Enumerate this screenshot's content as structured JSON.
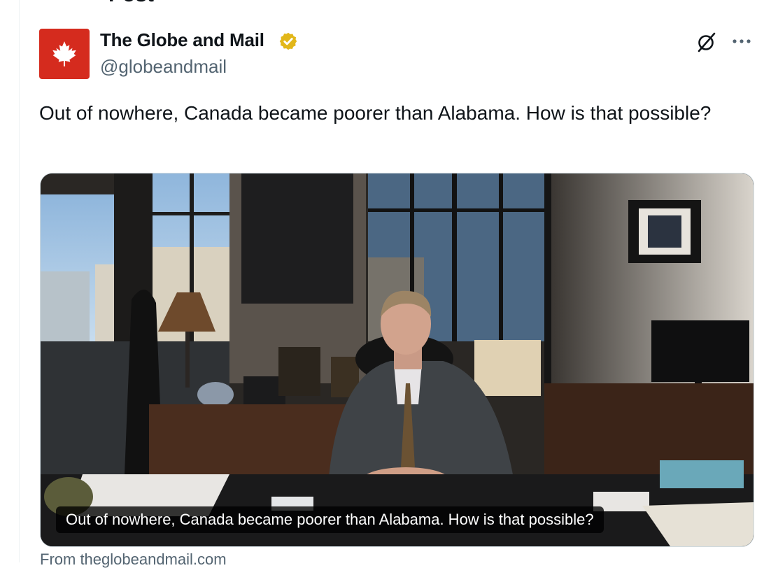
{
  "page": {
    "title_fragment": "Post"
  },
  "tweet": {
    "author_name": "The Globe and Mail",
    "handle": "@globeandmail",
    "text": "Out of nowhere, Canada became poorer than Alabama. How is that possible?",
    "verified": true,
    "avatar_color": "#d52b1e",
    "verified_color": "#e2b719"
  },
  "media": {
    "caption": "Out of nowhere, Canada became poorer than Alabama. How is that possible?",
    "source": "From theglobeandmail.com"
  },
  "icons": {
    "avatar": "maple-leaf-icon",
    "verified": "verified-badge-icon",
    "grok": "grok-icon",
    "more": "more-options-icon"
  }
}
